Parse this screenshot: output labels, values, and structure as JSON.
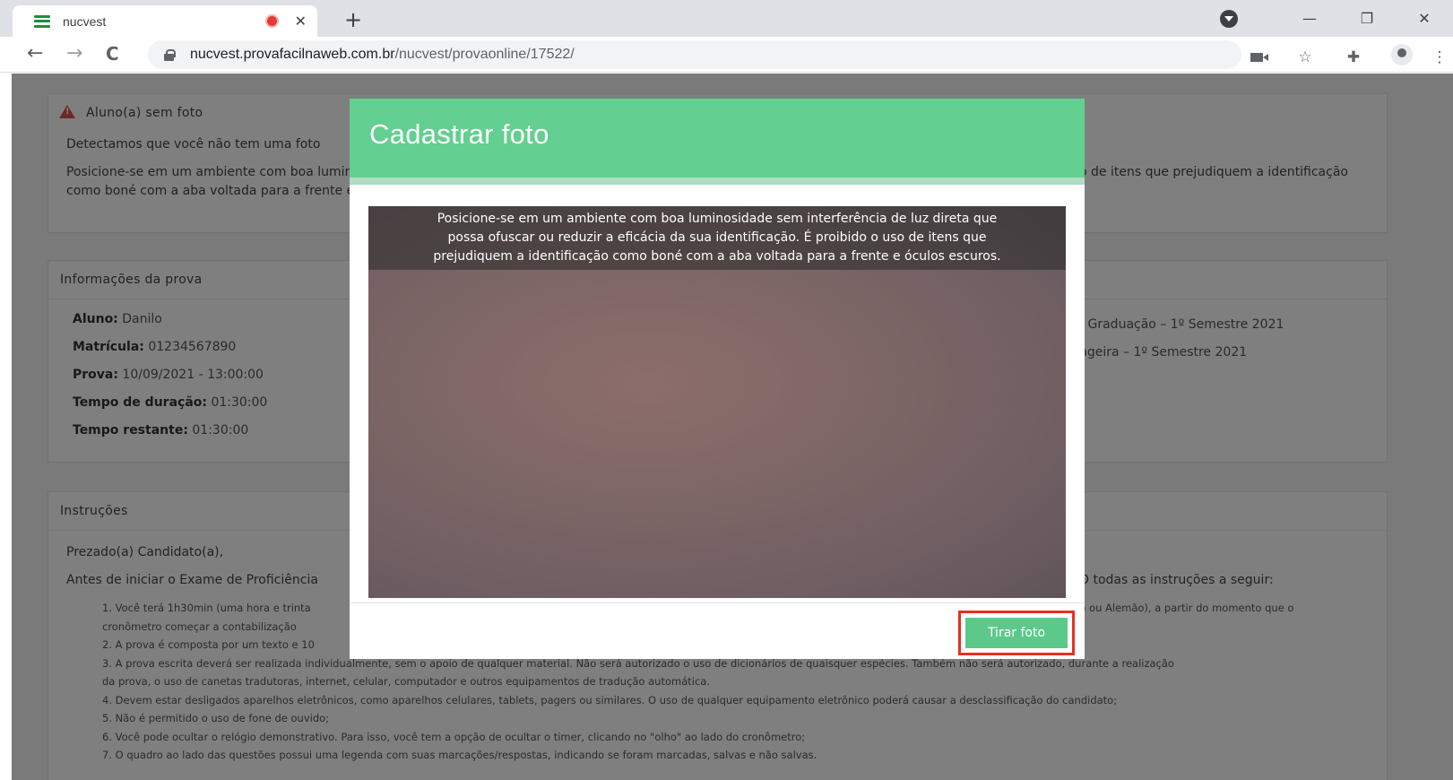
{
  "browser": {
    "tab_title": "nucvest",
    "tab_close": "✕",
    "new_tab": "+",
    "url_host": "nucvest.provafacilnaweb.com.br",
    "url_path": "/nucvest/provaonline/17522/",
    "nav_back": "←",
    "nav_forward": "→",
    "nav_reload": "C",
    "minimize": "—",
    "restore": "❐",
    "close": "✕",
    "star": "☆",
    "menu": "⋮",
    "extensions": "✚"
  },
  "alert": {
    "title": "Aluno(a) sem foto",
    "line1": "Detectamos que você não tem uma foto",
    "line2": "Posicione-se em um ambiente com boa luminosidade sem interferência de luz direta que possa ofuscar ou reduzir a eficácia da sua identificação. É proibido o uso de itens que prejudiquem a identificação como boné com a aba voltada para a frente e óculos escuros."
  },
  "info": {
    "title": "Informações da prova",
    "aluno_label": "Aluno:",
    "aluno_value": "Danilo",
    "matricula_label": "Matrícula:",
    "matricula_value": "01234567890",
    "prova_label": "Prova:",
    "prova_value": "10/09/2021 - 13:00:00",
    "duracao_label": "Tempo de duração:",
    "duracao_value": "01:30:00",
    "restante_label": "Tempo restante:",
    "restante_value": "01:30:00",
    "right_line1": "- Graduação – 1º Semestre 2021",
    "right_line2": "ngeira – 1º Semestre 2021"
  },
  "instructions": {
    "title": "Instruções",
    "greeting": "Prezado(a) Candidato(a),",
    "intro_left": "Antes de iniciar o Exame de Proficiência",
    "intro_right": "O todas as instruções a seguir:",
    "items": [
      "1. Você terá 1h30min (uma hora e trinta",
      "cronômetro começar a contabilização",
      "2. A prova é composta por um texto e 10",
      "3. A prova escrita deverá ser realizada individualmente, sem o apoio de qualquer material. Não será autorizado o uso de dicionários de quaisquer espécies. Também não será autorizado, durante a realização",
      "da prova, o uso de canetas tradutoras, internet, celular, computador e outros equipamentos de tradução automática.",
      "4. Devem estar desligados aparelhos eletrônicos, como aparelhos celulares, tablets, pagers ou similares. O uso de qualquer equipamento eletrônico poderá causar a desclassificação do candidato;",
      "5. Não é permitido o uso de fone de ouvido;",
      "6. Você pode ocultar o relógio demonstrativo. Para isso, você tem a opção de ocultar o timer, clicando no \"olho\" ao lado do cronômetro;",
      "7. O quadro ao lado das questões possui uma legenda com suas marcações/respostas, indicando se foram marcadas, salvas e não salvas."
    ],
    "item1_right": "ano ou Alemão), a partir do momento que o"
  },
  "modal": {
    "title": "Cadastrar foto",
    "caption_line1": "Posicione-se em um ambiente com boa luminosidade sem interferência de luz direta que",
    "caption_line2": "possa ofuscar ou reduzir a eficácia da sua identificação. É proibido o uso de itens que",
    "caption_line3": "prejudiquem a identificação como boné com a aba voltada para a frente e óculos escuros.",
    "button": "Tirar foto"
  },
  "colors": {
    "modal_header": "#63cf90",
    "button": "#5cc98a",
    "highlight": "#e53020",
    "warning": "#d9534f"
  }
}
